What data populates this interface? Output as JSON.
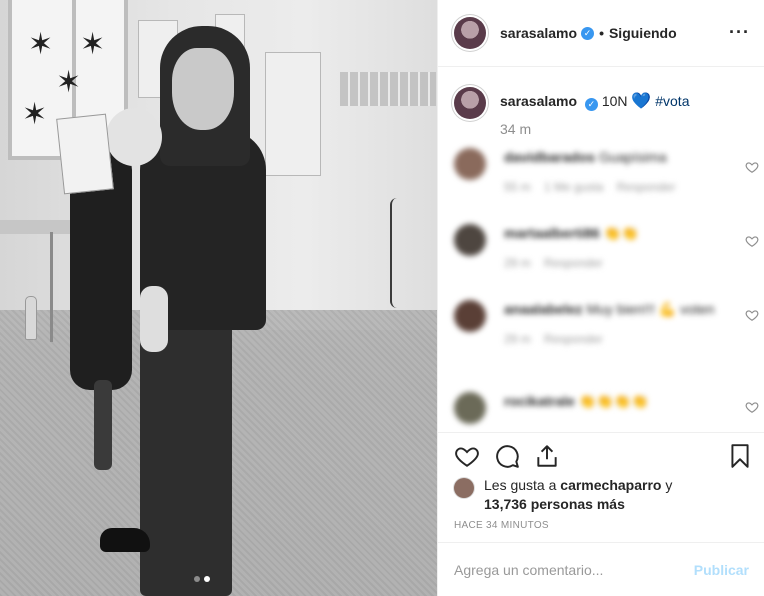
{
  "post": {
    "carousel": {
      "count": 2,
      "active_index": 1
    }
  },
  "header": {
    "username": "sarasalamo",
    "verified_symbol": "✓",
    "separator": "•",
    "follow_label": "Siguiendo",
    "more_icon": "···"
  },
  "caption": {
    "username": "sarasalamo",
    "text": "10N",
    "emoji": "💙",
    "hashtag": "#vota",
    "time": "34 m"
  },
  "comments": [
    {
      "user": "davidbarados",
      "text": "Guapísima",
      "meta": [
        "55 m",
        "1 Me gusta",
        "Responder"
      ]
    },
    {
      "user": "martaalberti86",
      "text": "👏👏",
      "meta": [
        "29 m",
        "Responder"
      ]
    },
    {
      "user": "anaalabelez",
      "text": "Muy bien!!! 💪 voten",
      "meta": [
        "29 m",
        "Responder"
      ]
    },
    {
      "user": "rocikatrale",
      "text": "👏👏👏👏",
      "meta": []
    }
  ],
  "likes": {
    "prefix": "Les gusta a",
    "user": "carmechaparro",
    "connector": "y",
    "count": "13,736",
    "suffix": "personas más"
  },
  "posted_ago": "HACE 34 MINUTOS",
  "add_comment": {
    "placeholder": "Agrega un comentario...",
    "publish_label": "Publicar"
  },
  "colors": {
    "accent_blue": "#3897f0",
    "hashtag": "#003569",
    "publish_disabled": "#b2dffc",
    "muted": "#8e8e8e"
  },
  "icons": [
    "heart-icon",
    "comment-icon",
    "share-icon",
    "bookmark-icon",
    "verified-icon",
    "more-icon"
  ]
}
